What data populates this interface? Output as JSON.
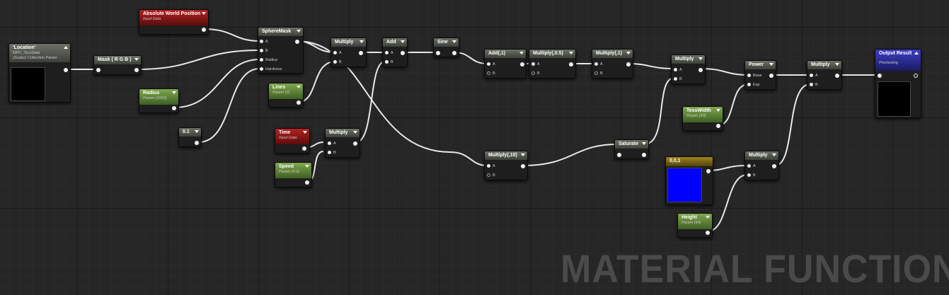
{
  "nodes": {
    "absolute_world_position": {
      "title": "Absolute World Position",
      "subtitle": "Input Data"
    },
    "location": {
      "title": "'Location'",
      "subtitle": "MPC_TessData",
      "subtitle2": "(Scalar) Collection Param"
    },
    "mask": {
      "title": "Mask ( R G B )"
    },
    "spheremask": {
      "title": "SphereMask",
      "pins": [
        "A",
        "B",
        "Radius",
        "Hardness"
      ]
    },
    "radius": {
      "title": "Radius",
      "subtitle": "Param (1000)"
    },
    "const_01": {
      "title": "0.1"
    },
    "lines": {
      "title": "Lines",
      "subtitle": "Param (2)"
    },
    "time": {
      "title": "Time",
      "subtitle": "Input Data"
    },
    "speed": {
      "title": "Speed",
      "subtitle": "Param (0.6)"
    },
    "multiply_1": {
      "title": "Multiply",
      "pins": [
        "A",
        "B"
      ]
    },
    "add_1": {
      "title": "Add",
      "pins": [
        "A",
        "B"
      ]
    },
    "multiply_time": {
      "title": "Multiply",
      "pins": [
        "A",
        "B"
      ]
    },
    "sine": {
      "title": "Sine"
    },
    "add_const": {
      "title": "Add(,1)",
      "pins": [
        "A",
        "B"
      ]
    },
    "mul_05": {
      "title": "Multiply(,0.5)",
      "pins": [
        "A",
        "B"
      ]
    },
    "mul_1": {
      "title": "Multiply(,1)",
      "pins": [
        "A",
        "B"
      ]
    },
    "mul_10": {
      "title": "Multiply(,10)",
      "pins": [
        "A",
        "B"
      ]
    },
    "saturate": {
      "title": "Saturate"
    },
    "multiply_2": {
      "title": "Multiply",
      "pins": [
        "A",
        "B"
      ]
    },
    "power": {
      "title": "Power",
      "pins": [
        "Base",
        "Exp"
      ]
    },
    "tesswidth": {
      "title": "TessWidth",
      "subtitle": "Param (20)"
    },
    "vector": {
      "title": "0,0,1",
      "color": "#0000ff"
    },
    "height": {
      "title": "Height",
      "subtitle": "Param (40)"
    },
    "multiply_3": {
      "title": "Multiply",
      "pins": [
        "A",
        "B"
      ]
    },
    "multiply_4": {
      "title": "Multiply",
      "pins": [
        "A",
        "B"
      ]
    },
    "output": {
      "title": "Output Result",
      "subtitle": "Previewing"
    }
  },
  "watermark": "MATERIAL FUNCTION",
  "colors": {
    "canvas": "#262626",
    "wire": "#e8e8e8",
    "param_header": "#5e8a33",
    "input_header": "#8c1a1a",
    "output_header": "#2a2a90",
    "vector_header": "#7a6414",
    "vector_preview": "#0000ff"
  }
}
